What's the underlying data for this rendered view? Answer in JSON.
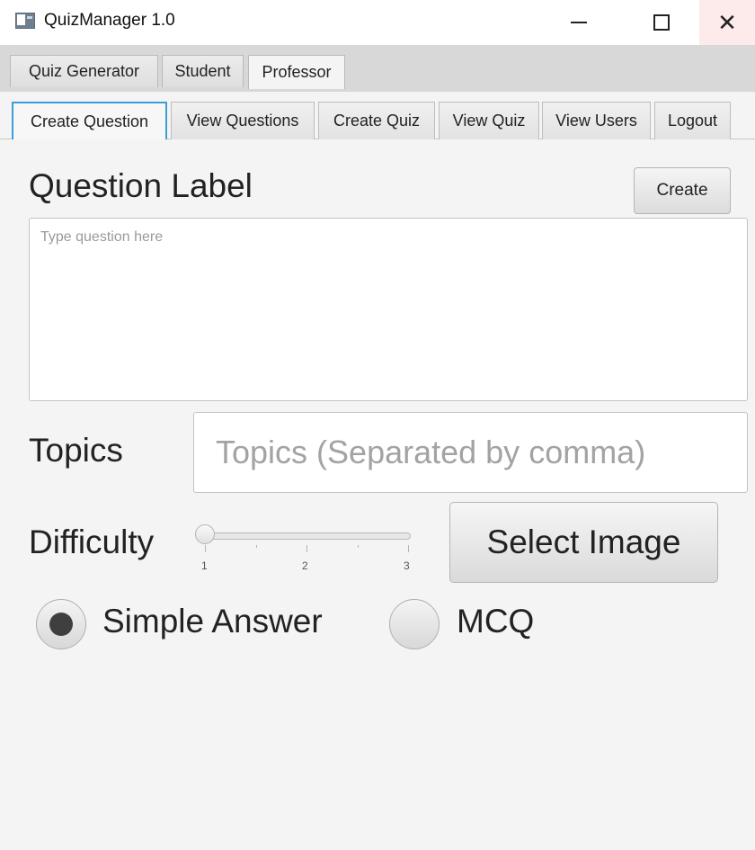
{
  "window": {
    "title": "QuizManager 1.0",
    "icon": "app-window-icon",
    "controls": {
      "minimize": "minimize-icon",
      "maximize": "maximize-icon",
      "close": "close-icon"
    }
  },
  "main_tabs": [
    {
      "label": "Quiz Generator",
      "active": false
    },
    {
      "label": "Student",
      "active": false
    },
    {
      "label": "Professor",
      "active": true
    }
  ],
  "professor_tabs": [
    {
      "label": "Create Question",
      "active": true
    },
    {
      "label": "View Questions",
      "active": false
    },
    {
      "label": "Create Quiz",
      "active": false
    },
    {
      "label": "View Quiz",
      "active": false
    },
    {
      "label": "View Users",
      "active": false
    },
    {
      "label": "Logout",
      "active": false
    }
  ],
  "form": {
    "question_label": "Question Label",
    "create_button": "Create",
    "question_placeholder": "Type question here",
    "question_value": "",
    "topics_label": "Topics",
    "topics_placeholder": "Topics (Separated by comma)",
    "topics_value": "",
    "difficulty_label": "Difficulty",
    "difficulty": {
      "min": 1,
      "max": 3,
      "value": 1,
      "tick_labels": [
        "1",
        "2",
        "3"
      ]
    },
    "select_image_button": "Select Image",
    "answer_type": {
      "selected": "Simple Answer",
      "options": [
        "Simple Answer",
        "MCQ"
      ]
    }
  },
  "colors": {
    "focus_accent": "#3a9fd8",
    "background": "#f4f4f4",
    "close_hover": "#fcebea"
  }
}
